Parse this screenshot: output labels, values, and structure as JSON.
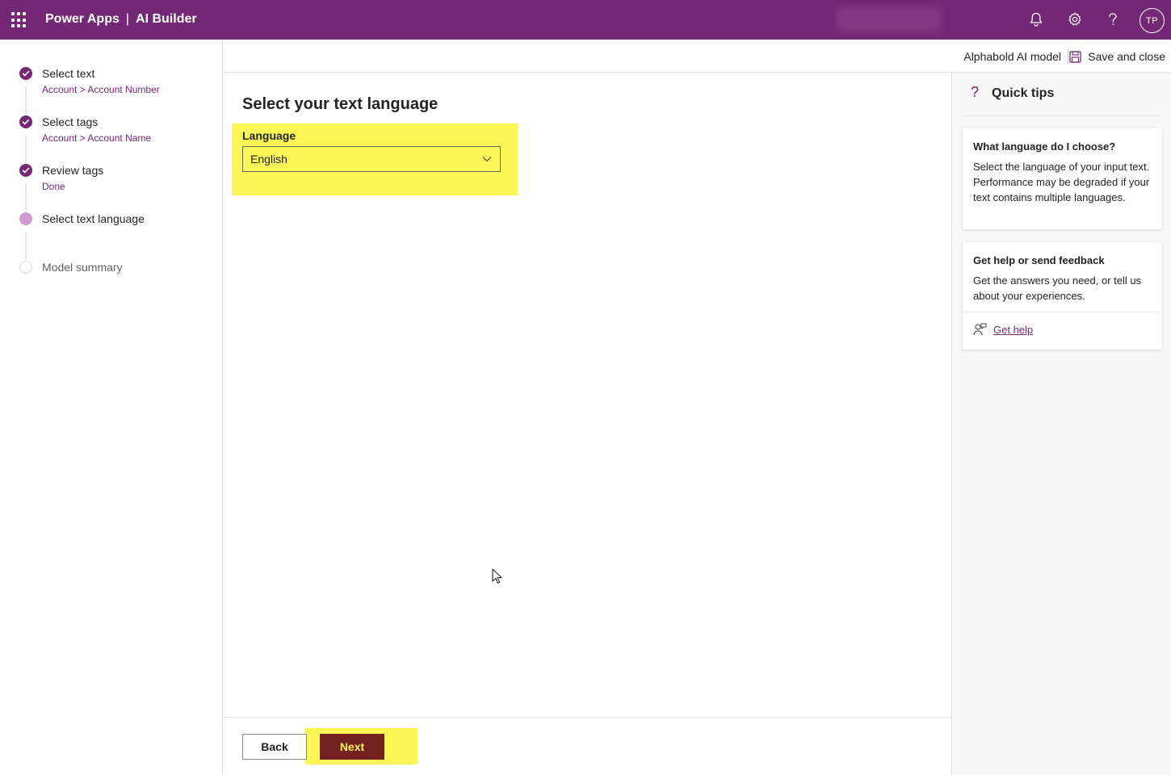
{
  "header": {
    "app_name": "Power Apps",
    "separator": "|",
    "product": "AI Builder",
    "avatar_initials": "TP",
    "brand_color": "#742774",
    "icons": [
      "app-launcher-icon",
      "bell-icon",
      "gear-icon",
      "help-icon"
    ]
  },
  "steps": [
    {
      "label": "Select text",
      "sub": "Account > Account Number",
      "state": "done"
    },
    {
      "label": "Select tags",
      "sub": "Account > Account Name",
      "state": "done"
    },
    {
      "label": "Review tags",
      "sub": "Done",
      "state": "done"
    },
    {
      "label": "Select text language",
      "sub": "",
      "state": "current"
    },
    {
      "label": "Model summary",
      "sub": "",
      "state": "pending"
    }
  ],
  "command_bar": {
    "model_name": "Alphabold AI model",
    "save_close_label": "Save and close"
  },
  "main": {
    "title": "Select your text language",
    "language_label": "Language",
    "language_value": "English",
    "highlight_color": "#fdf657"
  },
  "footer": {
    "back_label": "Back",
    "next_label": "Next"
  },
  "tips": {
    "title": "Quick tips",
    "card1": {
      "heading": "What language do I choose?",
      "body": "Select the language of your input text. Performance may be degraded if your text contains multiple languages."
    },
    "card2": {
      "heading": "Get help or send feedback",
      "body": "Get the answers you need, or tell us about your experiences.",
      "link": "Get help"
    }
  }
}
